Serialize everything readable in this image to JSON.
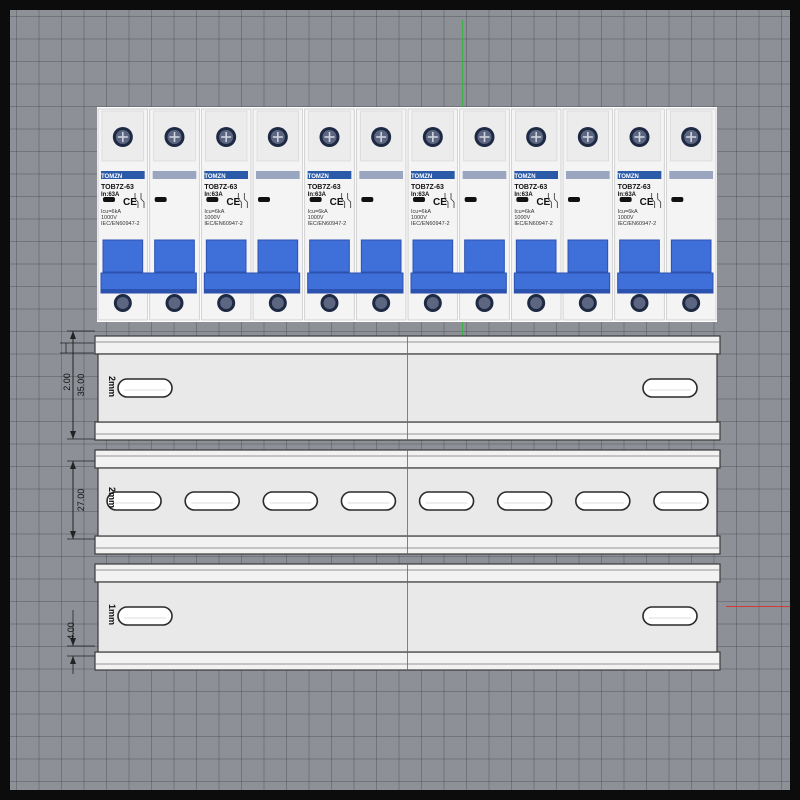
{
  "viewport": {
    "grid_color": "#8d9197",
    "axis_colors": {
      "y": "#3db048",
      "x": "#d23a3a"
    }
  },
  "breakers": {
    "count": 6,
    "brand": "TOMZN",
    "model": "TOB7Z-63",
    "rating": "In:63A",
    "icu": "Icu=6kA",
    "voltage": "1000V",
    "standard": "IEC/EN60947-2",
    "ce_mark": "CE",
    "body_color": "#f4f4f4",
    "handle_color": "#3f6fd8",
    "handle_dark": "#2c52b0"
  },
  "rails": [
    {
      "name": "rail-top",
      "slots_per_half": 1,
      "dimensions": [
        "35.00",
        "2.00"
      ],
      "mm_label": "2mm"
    },
    {
      "name": "rail-middle",
      "slots_per_half": 4,
      "dimensions": [
        "27.00"
      ],
      "mm_label": "2mm"
    },
    {
      "name": "rail-bottom",
      "slots_per_half": 1,
      "dimensions": [
        "4.00"
      ],
      "mm_label": "1mm"
    }
  ]
}
